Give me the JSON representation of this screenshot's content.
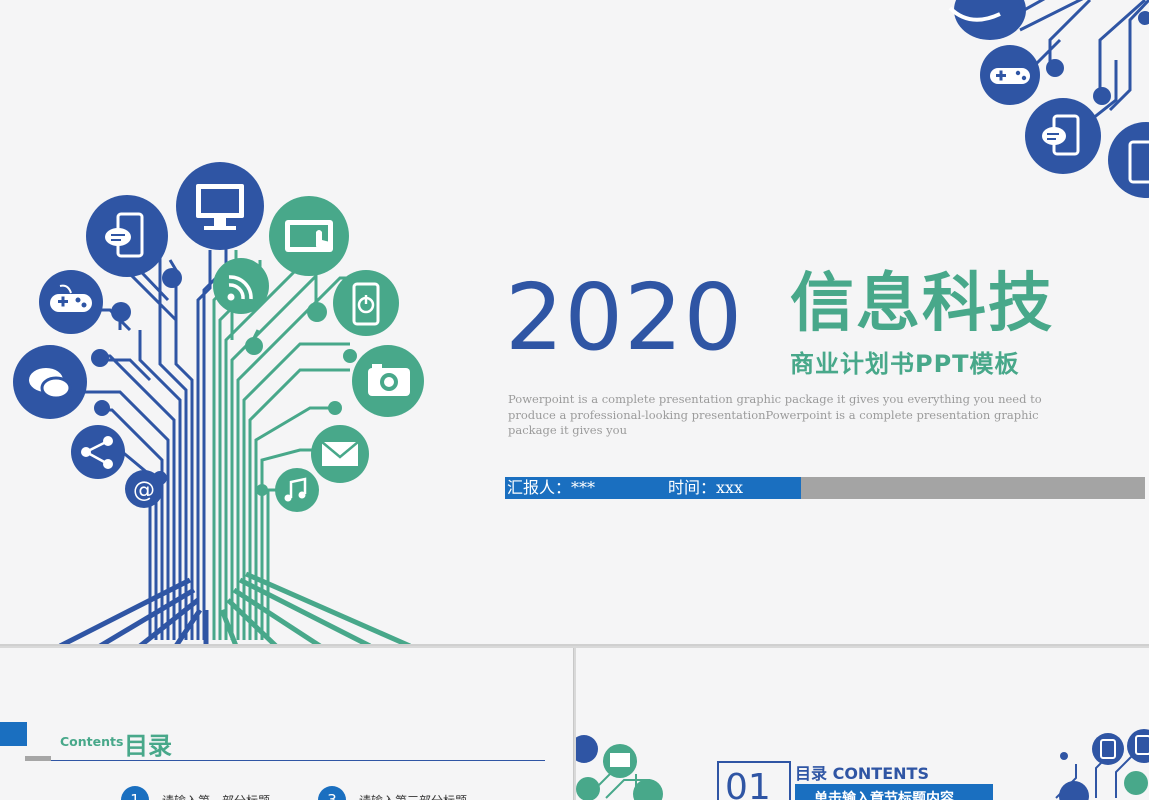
{
  "cover": {
    "year": "2020",
    "title": "信息科技",
    "subtitle": "商业计划书PPT模板",
    "description": "Powerpoint is a complete presentation graphic package it gives you everything you need to produce a professional-looking presentationPowerpoint is a complete presentation graphic package it gives you",
    "reporter": "汇报人：***",
    "time": "时间：xxx"
  },
  "contents": {
    "label_en": "Contents",
    "label_cn": "目录",
    "items": [
      {
        "num": "1",
        "text": "请输入第一部分标题"
      },
      {
        "num": "3",
        "text": "请输入第三部分标题"
      }
    ]
  },
  "section": {
    "num": "01",
    "title": "目录 CONTENTS",
    "subtitle": "单击输入章节标题内容"
  },
  "colors": {
    "blue": "#2f55a4",
    "green": "#48a88a",
    "bar_blue": "#1a6fc0",
    "bar_gray": "#a4a4a4"
  },
  "icons": {
    "tree": [
      "chat-bubbles-icon",
      "gamepad-icon",
      "phone-chat-icon",
      "monitor-icon",
      "touch-tablet-icon",
      "wifi-icon",
      "power-phone-icon",
      "camera-icon",
      "mail-icon",
      "music-icon",
      "share-icon",
      "at-icon"
    ],
    "corner": [
      "gamepad-icon",
      "phone-chat-icon",
      "tablet-icon"
    ]
  }
}
